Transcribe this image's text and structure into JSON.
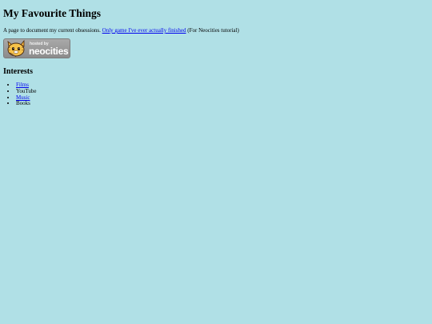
{
  "page": {
    "title": "My Favourite Things",
    "background_color": "#b0e0e6"
  },
  "intro": {
    "text_before": "A page to document my current obsessions. ",
    "link_text": "Only game I've ever actually finished",
    "text_after": " (For Neocities tutorial)"
  },
  "badge": {
    "small_text": "hosted by",
    "big_text": "neocities",
    "icon": "neocities-cat-icon"
  },
  "interests": {
    "heading": "Interests",
    "items": [
      {
        "label": "Films",
        "is_link": true
      },
      {
        "label": "YouTube",
        "is_link": false
      },
      {
        "label": "Music",
        "is_link": true
      },
      {
        "label": "Books",
        "is_link": false
      }
    ]
  }
}
